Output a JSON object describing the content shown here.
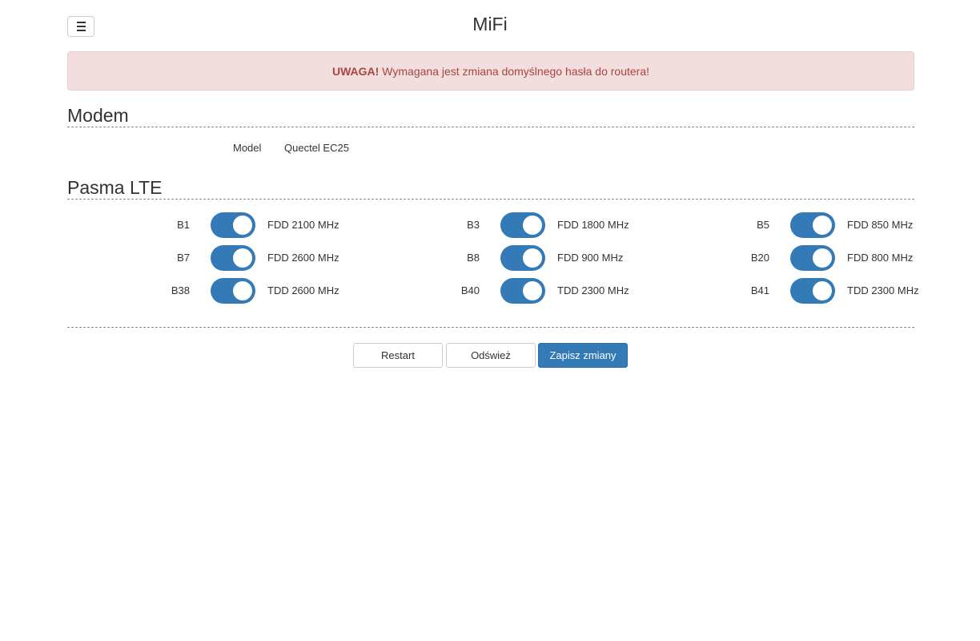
{
  "header": {
    "menu_icon": "hamburger-icon",
    "title": "MiFi"
  },
  "alert": {
    "strong": "UWAGA!",
    "message": "Wymagana jest zmiana domyślnego hasła do routera!",
    "color": "#a94442",
    "background": "#f2dede"
  },
  "modem": {
    "section_title": "Modem",
    "model_label": "Model",
    "model_value": "Quectel EC25"
  },
  "lte": {
    "section_title": "Pasma LTE",
    "toggle_color": "#337ab7",
    "bands": [
      {
        "id": "B1",
        "desc": "FDD 2100 MHz",
        "enabled": true
      },
      {
        "id": "B3",
        "desc": "FDD 1800 MHz",
        "enabled": true
      },
      {
        "id": "B5",
        "desc": "FDD 850 MHz",
        "enabled": true
      },
      {
        "id": "B7",
        "desc": "FDD 2600 MHz",
        "enabled": true
      },
      {
        "id": "B8",
        "desc": "FDD 900 MHz",
        "enabled": true
      },
      {
        "id": "B20",
        "desc": "FDD 800 MHz",
        "enabled": true
      },
      {
        "id": "B38",
        "desc": "TDD 2600 MHz",
        "enabled": true
      },
      {
        "id": "B40",
        "desc": "TDD 2300 MHz",
        "enabled": true
      },
      {
        "id": "B41",
        "desc": "TDD 2300 MHz",
        "enabled": true
      }
    ]
  },
  "actions": {
    "restart_label": "Restart",
    "refresh_label": "Odśwież",
    "save_label": "Zapisz zmiany",
    "primary_color": "#337ab7"
  }
}
